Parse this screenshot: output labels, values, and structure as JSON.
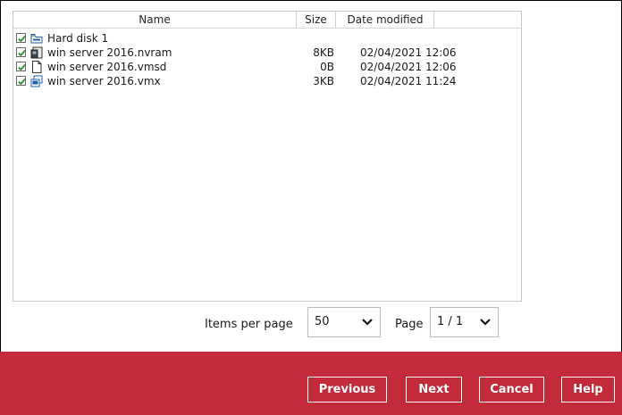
{
  "table": {
    "columns": {
      "name": "Name",
      "size": "Size",
      "date": "Date modified"
    },
    "rows": [
      {
        "name": "Hard disk 1",
        "size": "",
        "date": "",
        "checked": true,
        "icon": "hard-disk-icon"
      },
      {
        "name": "win server 2016.nvram",
        "size": "8KB",
        "date": "02/04/2021 12:06",
        "checked": true,
        "icon": "nvram-file-icon"
      },
      {
        "name": "win server 2016.vmsd",
        "size": "0B",
        "date": "02/04/2021 12:06",
        "checked": true,
        "icon": "blank-file-icon"
      },
      {
        "name": "win server 2016.vmx",
        "size": "3KB",
        "date": "02/04/2021 11:24",
        "checked": true,
        "icon": "vmx-file-icon"
      }
    ]
  },
  "pager": {
    "items_per_page_label": "Items per page",
    "items_per_page_value": "50",
    "page_label": "Page",
    "page_value": "1 / 1"
  },
  "footer": {
    "previous": "Previous",
    "next": "Next",
    "cancel": "Cancel",
    "help": "Help"
  },
  "colors": {
    "footer_bg": "#c32a3a",
    "checkbox_tick": "#2f8f2f"
  }
}
